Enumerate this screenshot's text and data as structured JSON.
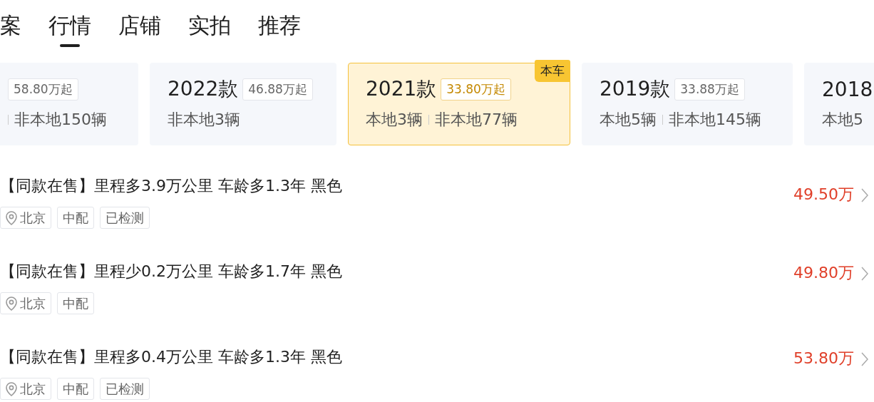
{
  "tabs": [
    {
      "label": "案",
      "selected": false
    },
    {
      "label": "行情",
      "selected": true
    },
    {
      "label": "店铺",
      "selected": false
    },
    {
      "label": "实拍",
      "selected": false
    },
    {
      "label": "推荐",
      "selected": false
    }
  ],
  "cards": [
    {
      "price": "58.80万起",
      "nonlocal": "非本地150辆",
      "selected": false,
      "lead": true
    },
    {
      "title": "2022款",
      "price": "46.88万起",
      "nonlocal": "非本地3辆",
      "selected": false
    },
    {
      "title": "2021款",
      "price": "33.80万起",
      "local": "本地3辆",
      "nonlocal": "非本地77辆",
      "selected": true,
      "badge": "本车"
    },
    {
      "title": "2019款",
      "price": "33.88万起",
      "local": "本地5辆",
      "nonlocal": "非本地145辆",
      "selected": false
    },
    {
      "title": "2018",
      "local": "本地5",
      "selected": false
    }
  ],
  "listings": [
    {
      "title": "【同款在售】里程多3.9万公里 车龄多1.3年 黑色",
      "price": "49.50万",
      "tags": [
        {
          "label": "北京",
          "kind": "location"
        },
        {
          "label": "中配",
          "kind": "plain"
        },
        {
          "label": "已检测",
          "kind": "plain"
        }
      ]
    },
    {
      "title": "【同款在售】里程少0.2万公里 车龄多1.7年 黑色",
      "price": "49.80万",
      "tags": [
        {
          "label": "北京",
          "kind": "location"
        },
        {
          "label": "中配",
          "kind": "plain"
        }
      ]
    },
    {
      "title": "【同款在售】里程多0.4万公里 车龄多1.3年 黑色",
      "price": "53.80万",
      "tags": [
        {
          "label": "北京",
          "kind": "location"
        },
        {
          "label": "中配",
          "kind": "plain"
        },
        {
          "label": "已检测",
          "kind": "plain"
        }
      ]
    }
  ]
}
